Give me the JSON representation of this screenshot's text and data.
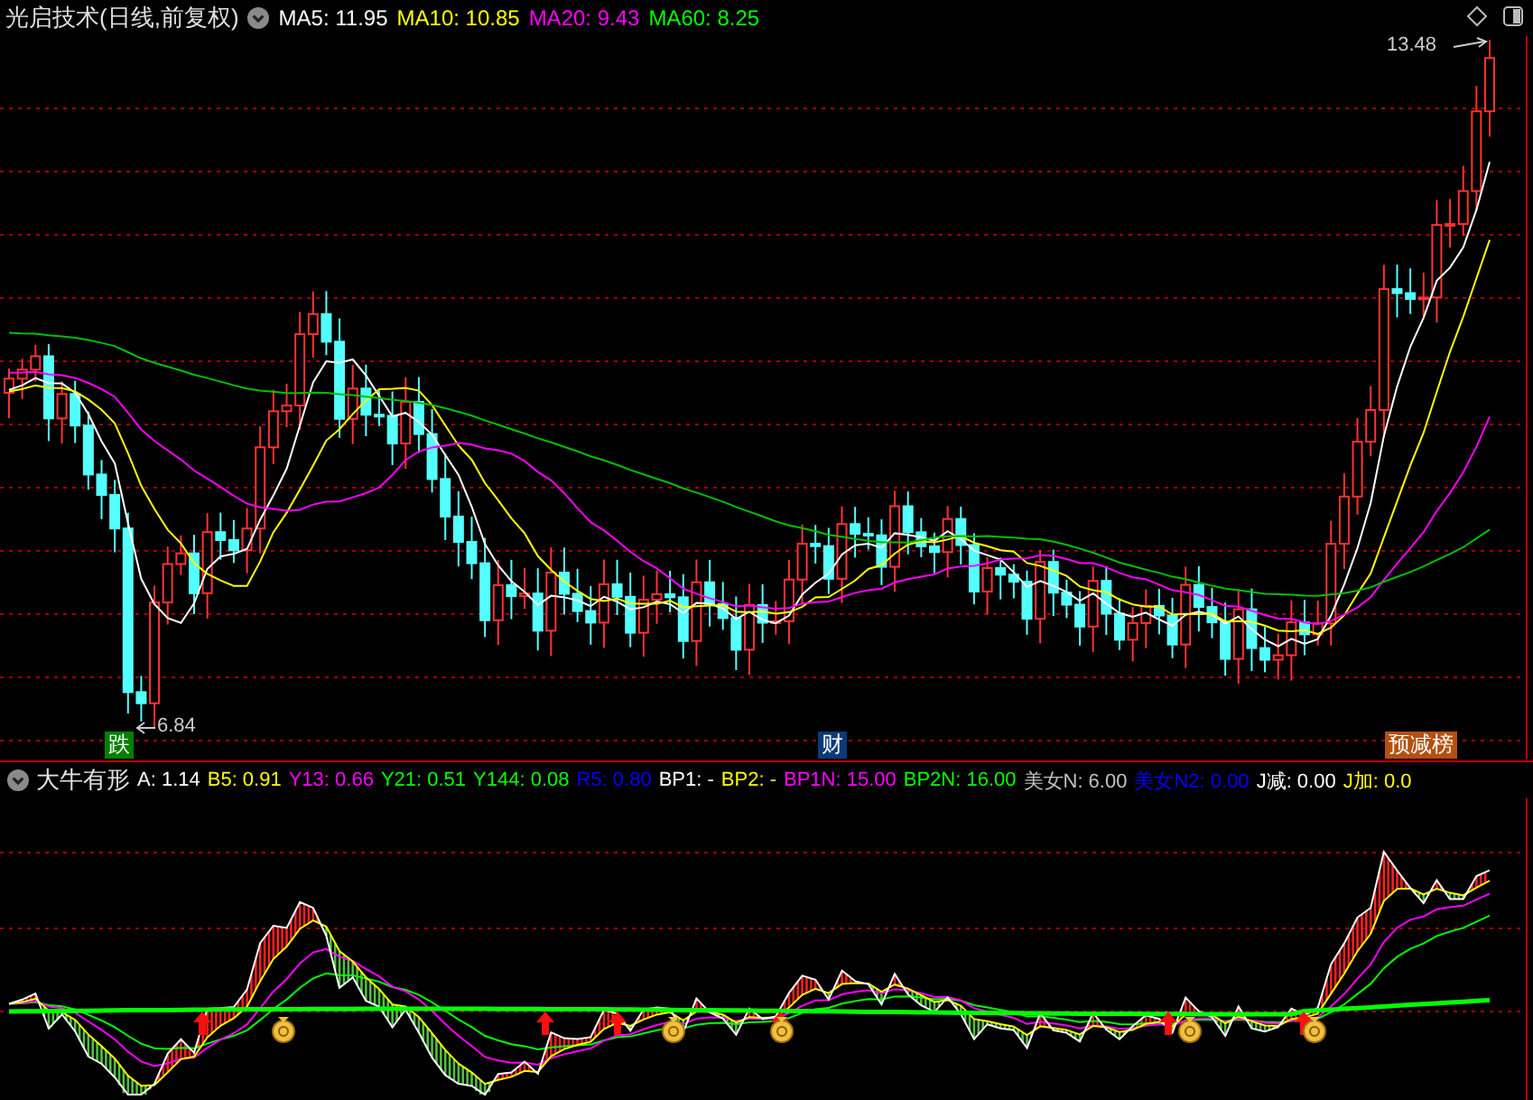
{
  "chart_title": "光启技术(日线,前复权)",
  "ma_legend": [
    {
      "label": "MA5: 11.95",
      "color": "#ffffff"
    },
    {
      "label": "MA10: 10.85",
      "color": "#ffff00"
    },
    {
      "label": "MA20: 9.43",
      "color": "#ff00ff"
    },
    {
      "label": "MA60: 8.25",
      "color": "#00ff00"
    }
  ],
  "price_marks": {
    "high": "13.48",
    "low": "6.84"
  },
  "signals": [
    {
      "label": "跌",
      "color": "#008000"
    },
    {
      "label": "财",
      "color": "#0a3a78"
    },
    {
      "label": "预减榜",
      "color": "#b4500f"
    }
  ],
  "indicator": {
    "name": "大牛有形",
    "legend": [
      {
        "label": "A: 1.14",
        "color": "#ffffff"
      },
      {
        "label": "B5: 0.91",
        "color": "#ffff00"
      },
      {
        "label": "Y13: 0.66",
        "color": "#ff00ff"
      },
      {
        "label": "Y21: 0.51",
        "color": "#00ff00"
      },
      {
        "label": "Y144: 0.08",
        "color": "#00ff00"
      },
      {
        "label": "R5: 0.80",
        "color": "#0000ff"
      },
      {
        "label": "BP1: -",
        "color": "#ffffff"
      },
      {
        "label": "BP2: -",
        "color": "#ffff00"
      },
      {
        "label": "BP1N: 15.00",
        "color": "#ff00ff"
      },
      {
        "label": "BP2N: 16.00",
        "color": "#00ff00"
      },
      {
        "label": "美女N: 6.00",
        "color": "#c0c0c0"
      },
      {
        "label": "美女N2: 0.00",
        "color": "#0000ff"
      },
      {
        "label": "J减: 0.00",
        "color": "#ffffff"
      },
      {
        "label": "J加: 0.0",
        "color": "#ffff00"
      }
    ]
  }
}
